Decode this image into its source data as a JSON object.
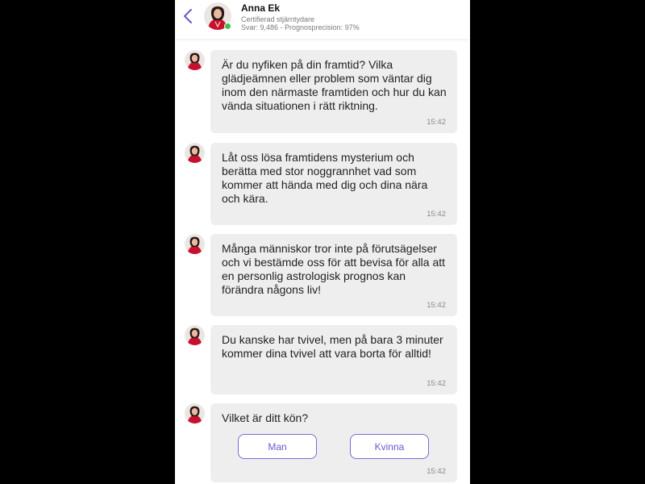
{
  "header": {
    "name": "Anna Ek",
    "role": "Certifierad stjärntydare",
    "stats": "Svar: 9,486 - Prognosprecision: 97%"
  },
  "colors": {
    "accent": "#6a5acd",
    "bubble": "#eeeeee",
    "online": "#3fbf4c",
    "frame": "#000000"
  },
  "messages": [
    {
      "text": "Är du nyfiken på din framtid? Vilka glädjeämnen eller problem som väntar dig inom den närmaste framtiden och hur du kan vända situationen i rätt riktning.",
      "time": "15:42"
    },
    {
      "text": "Låt oss lösa framtidens mysterium och berätta med stor noggrannhet vad som kommer att hända med dig och dina nära och kära.",
      "time": "15:42"
    },
    {
      "text": "Många människor tror inte på förutsägelser och vi bestämde oss för att bevisa för alla att en personlig astrologisk prognos kan förändra någons liv!",
      "time": "15:42"
    },
    {
      "text": "Du kanske har tvivel, men på bara 3 minuter kommer dina tvivel att vara borta för alltid!",
      "time": "15:42"
    },
    {
      "text": "Vilket är ditt kön?",
      "time": "15:42",
      "options": [
        "Man",
        "Kvinna"
      ]
    }
  ],
  "icons": {
    "back": "chevron-left-icon",
    "avatar": "advisor-avatar",
    "status": "online-status-dot"
  }
}
